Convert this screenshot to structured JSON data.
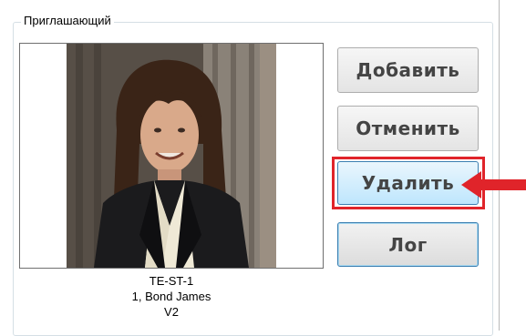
{
  "group": {
    "title": "Приглашающий"
  },
  "person": {
    "caption_line1": "TE-ST-1",
    "caption_line2": "1, Bond James",
    "caption_line3": "V2"
  },
  "buttons": {
    "add": "Добавить",
    "cancel": "Отменить",
    "delete": "Удалить",
    "log": "Лог"
  },
  "colors": {
    "highlight": "#e0242a",
    "button_text": "#444444",
    "focus_border": "#3c7fb1"
  },
  "icons": {
    "annotation": "red-arrow-icon"
  }
}
